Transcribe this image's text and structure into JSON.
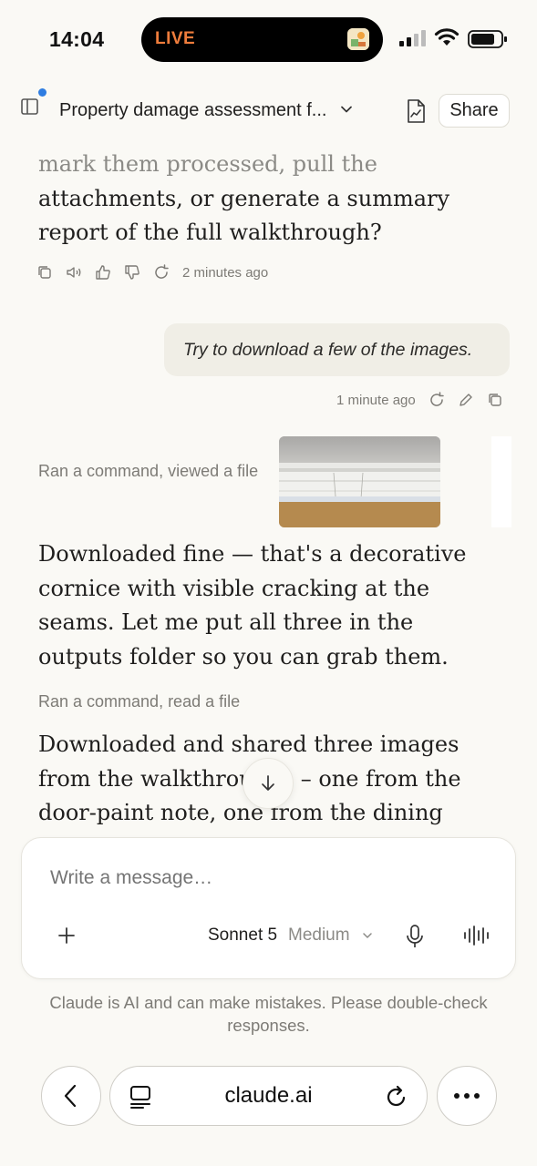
{
  "status_bar": {
    "time": "14:04",
    "live_label": "LIVE"
  },
  "header": {
    "title": "Property damage assessment f...",
    "share_label": "Share"
  },
  "assistant_prev": {
    "faded_line": "mark them processed, pull the",
    "text": "attachments, or generate a summary report of the full walkthrough?",
    "timestamp": "2 minutes ago"
  },
  "user_message": {
    "text": "Try to download a few of the images.",
    "timestamp": "1 minute ago"
  },
  "assistant_current": {
    "tool_1": "Ran a command, viewed a file",
    "para_1": "Downloaded fine — that's a decorative cornice with visible cracking at the seams. Let me put all three in the outputs folder so you can grab them.",
    "tool_2": "Ran a command, read a file",
    "para_2_line1": "Downloaded and shared three images",
    "para_2_line2_a": "from the walkthrou",
    "para_2_line2_b": "– one from the",
    "para_2_line3": "door-paint note, one from the dining"
  },
  "composer": {
    "placeholder": "Write a message…",
    "model": "Sonnet 5",
    "mode": "Medium"
  },
  "disclaimer": "Claude is AI and can make mistakes. Please double-check responses.",
  "browser": {
    "url": "claude.ai"
  },
  "icons": {
    "sidebar": "sidebar-icon",
    "chevron": "chevron-down-icon",
    "artifact": "document-chart-icon",
    "copy": "copy-icon",
    "speak": "speaker-icon",
    "thumbs_up": "thumbs-up-icon",
    "thumbs_down": "thumbs-down-icon",
    "retry": "retry-icon",
    "edit": "pencil-icon",
    "scroll": "arrow-down-icon",
    "plus": "plus-icon",
    "mic": "microphone-icon",
    "voice": "voice-waveform-icon",
    "back": "chevron-left-icon",
    "tabs": "tabs-icon",
    "reload": "reload-icon",
    "more": "ellipsis-icon"
  },
  "colors": {
    "live": "#ef7d3c",
    "notification_dot": "#2f7de1",
    "background": "#faf9f5"
  }
}
